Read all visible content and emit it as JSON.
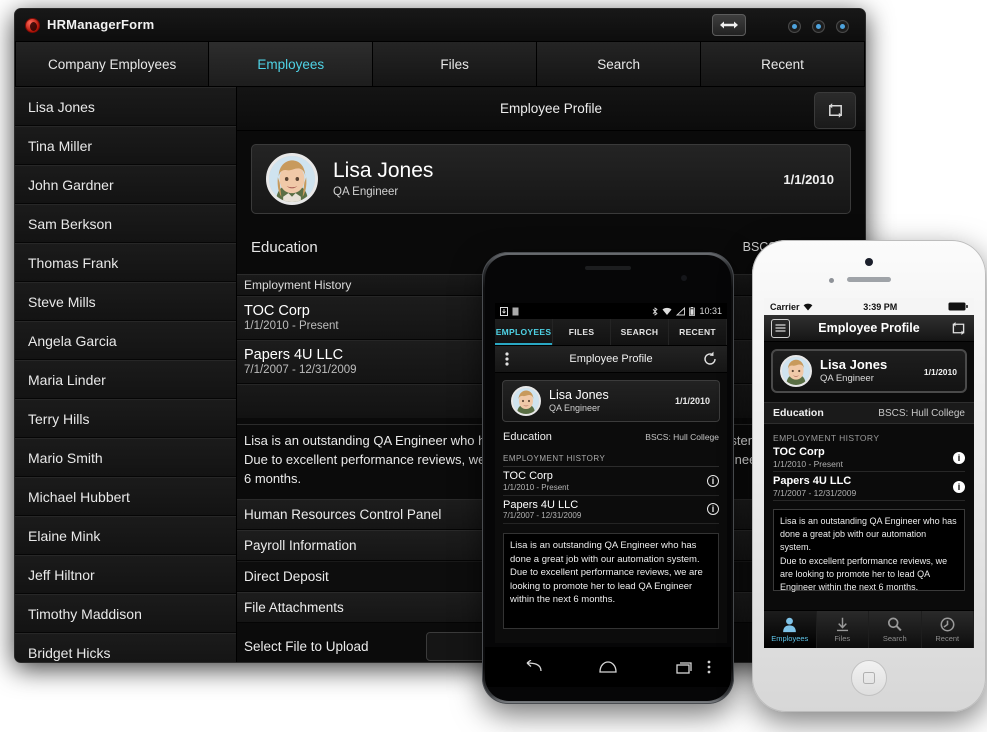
{
  "desktop": {
    "app_title": "HRManagerForm",
    "icons": {
      "app": "app-logo-icon",
      "resize": "resize-horizontal-icon",
      "sync": "sync-refresh-icon"
    },
    "tabs": [
      {
        "label": "Company Employees",
        "active": false
      },
      {
        "label": "Employees",
        "active": true
      },
      {
        "label": "Files",
        "active": false
      },
      {
        "label": "Search",
        "active": false
      },
      {
        "label": "Recent",
        "active": false
      }
    ],
    "employees": [
      "Lisa Jones",
      "Tina Miller",
      "John Gardner",
      "Sam Berkson",
      "Thomas Frank",
      "Steve Mills",
      "Angela Garcia",
      "Maria Linder",
      "Terry Hills",
      "Mario Smith",
      "Michael Hubbert",
      "Elaine Mink",
      "Jeff Hiltnor",
      "Timothy Maddison",
      "Bridget Hicks"
    ],
    "content_title": "Employee Profile",
    "profile": {
      "name": "Lisa Jones",
      "role": "QA Engineer",
      "date": "1/1/2010"
    },
    "education": {
      "label": "Education",
      "value": "BSCS: Hull College"
    },
    "employment_history": {
      "header": "Employment History",
      "items": [
        {
          "company": "TOC Corp",
          "dates": "1/1/2010 - Present"
        },
        {
          "company": "Papers 4U LLC",
          "dates": "7/1/2007 - 12/31/2009"
        }
      ]
    },
    "notes": "Lisa is an outstanding QA Engineer who has done a great job with our automation system.\nDue to excellent performance reviews, we are looking to promote her to lead QA Engineer within the next 6 months.",
    "panel_rows": [
      "Human Resources Control Panel",
      "Payroll Information",
      "Direct Deposit",
      "File Attachments"
    ],
    "upload": {
      "label": "Select File to Upload",
      "value": ""
    }
  },
  "android": {
    "status": {
      "time": "10:31",
      "icons": "sd-card, sim, bluetooth, wifi, signal, battery"
    },
    "tabs": [
      {
        "label": "EMPLOYEES",
        "active": true
      },
      {
        "label": "FILES",
        "active": false
      },
      {
        "label": "SEARCH",
        "active": false
      },
      {
        "label": "RECENT",
        "active": false
      }
    ],
    "action_bar": {
      "title": "Employee Profile",
      "overflow_icon": "kebab-menu-icon",
      "refresh_icon": "refresh-icon"
    },
    "profile": {
      "name": "Lisa Jones",
      "role": "QA Engineer",
      "date": "1/1/2010"
    },
    "education": {
      "label": "Education",
      "value": "BSCS: Hull College"
    },
    "employment_history": {
      "header": "EMPLOYMENT HISTORY",
      "items": [
        {
          "company": "TOC Corp",
          "dates": "1/1/2010 - Present"
        },
        {
          "company": "Papers 4U LLC",
          "dates": "7/1/2007 - 12/31/2009"
        }
      ]
    },
    "notes": "Lisa is an outstanding QA Engineer who has done a great job with our automation system.\nDue to excellent performance reviews, we are looking to promote her to lead QA Engineer within the next 6 months.",
    "navbar": {
      "back": "back-icon",
      "home": "home-icon",
      "recents": "recents-icon",
      "menu": "kebab-menu-icon"
    }
  },
  "iphone": {
    "status": {
      "carrier": "Carrier",
      "time": "3:39 PM",
      "wifi_icon": "wifi-icon",
      "battery_icon": "battery-icon"
    },
    "nav": {
      "title": "Employee Profile",
      "left_icon": "list-menu-icon",
      "right_icon": "sync-refresh-icon"
    },
    "profile": {
      "name": "Lisa Jones",
      "role": "QA Engineer",
      "date": "1/1/2010"
    },
    "education": {
      "label": "Education",
      "value": "BSCS: Hull College"
    },
    "employment_history": {
      "header": "EMPLOYMENT HISTORY",
      "items": [
        {
          "company": "TOC Corp",
          "dates": "1/1/2010 - Present"
        },
        {
          "company": "Papers 4U LLC",
          "dates": "7/1/2007 - 12/31/2009"
        }
      ]
    },
    "notes": "Lisa is an outstanding QA Engineer who has done a great job with our automation system.\nDue to excellent performance reviews, we are looking to promote her to lead QA Engineer within the next 6 months.",
    "tabs": [
      {
        "label": "Employees",
        "icon": "person-icon",
        "active": true
      },
      {
        "label": "Files",
        "icon": "download-icon",
        "active": false
      },
      {
        "label": "Search",
        "icon": "magnifier-icon",
        "active": false
      },
      {
        "label": "Recent",
        "icon": "clock-icon",
        "active": false
      }
    ]
  },
  "colors": {
    "accent": "#4fd3e6",
    "ios_accent": "#5fc4e8",
    "window_bg": "#0b0b0b"
  }
}
